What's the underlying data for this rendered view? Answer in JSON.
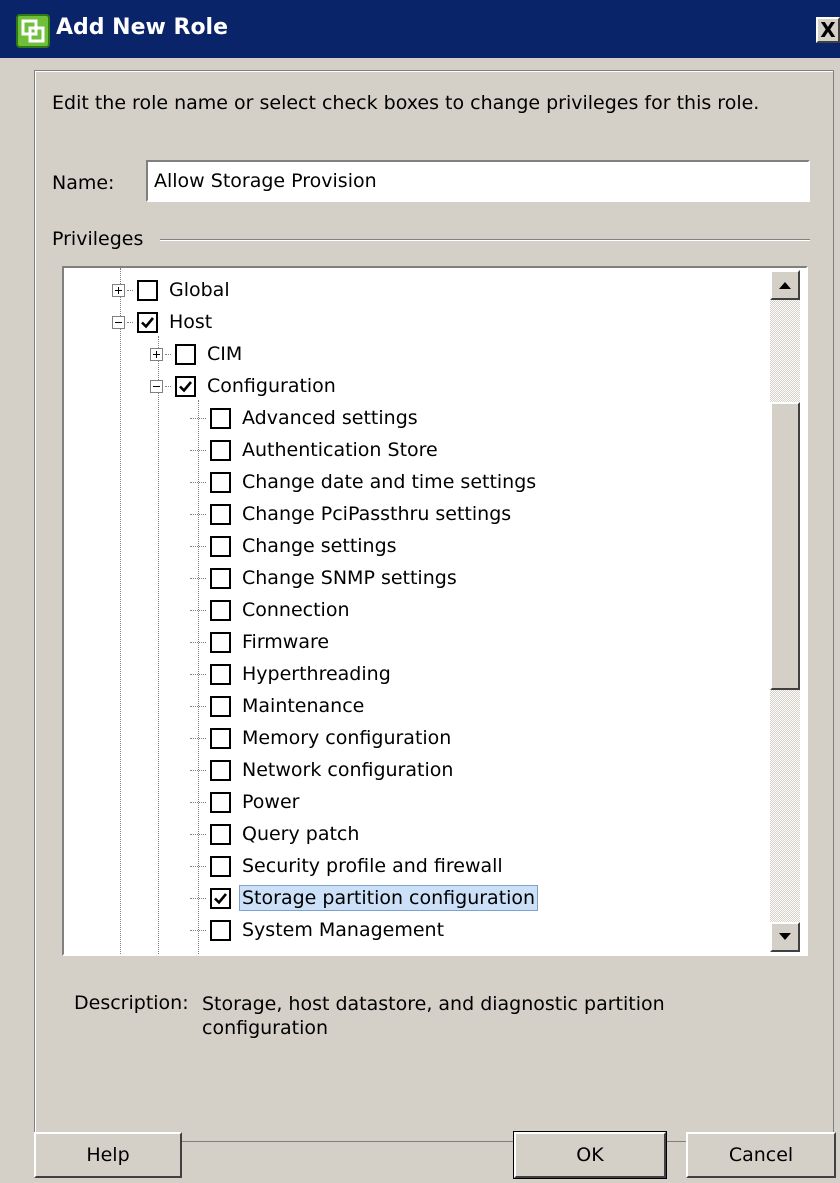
{
  "window": {
    "title": "Add New Role",
    "close_glyph": "X"
  },
  "instructions": "Edit the role name or select check boxes to change privileges for this role.",
  "name_field": {
    "label": "Name:",
    "value": "Allow Storage Provision"
  },
  "privileges": {
    "label": "Privileges",
    "tree": [
      {
        "label": "Global",
        "level": 0,
        "expander": "plus",
        "checked": false,
        "selected": false
      },
      {
        "label": "Host",
        "level": 0,
        "expander": "minus",
        "checked": true,
        "selected": false
      },
      {
        "label": "CIM",
        "level": 1,
        "expander": "plus",
        "checked": false,
        "selected": false
      },
      {
        "label": "Configuration",
        "level": 1,
        "expander": "minus",
        "checked": true,
        "selected": false
      },
      {
        "label": "Advanced settings",
        "level": 2,
        "expander": "none",
        "checked": false,
        "selected": false
      },
      {
        "label": "Authentication Store",
        "level": 2,
        "expander": "none",
        "checked": false,
        "selected": false
      },
      {
        "label": "Change date and time settings",
        "level": 2,
        "expander": "none",
        "checked": false,
        "selected": false
      },
      {
        "label": "Change PciPassthru settings",
        "level": 2,
        "expander": "none",
        "checked": false,
        "selected": false
      },
      {
        "label": "Change settings",
        "level": 2,
        "expander": "none",
        "checked": false,
        "selected": false
      },
      {
        "label": "Change SNMP settings",
        "level": 2,
        "expander": "none",
        "checked": false,
        "selected": false
      },
      {
        "label": "Connection",
        "level": 2,
        "expander": "none",
        "checked": false,
        "selected": false
      },
      {
        "label": "Firmware",
        "level": 2,
        "expander": "none",
        "checked": false,
        "selected": false
      },
      {
        "label": "Hyperthreading",
        "level": 2,
        "expander": "none",
        "checked": false,
        "selected": false
      },
      {
        "label": "Maintenance",
        "level": 2,
        "expander": "none",
        "checked": false,
        "selected": false
      },
      {
        "label": "Memory configuration",
        "level": 2,
        "expander": "none",
        "checked": false,
        "selected": false
      },
      {
        "label": "Network configuration",
        "level": 2,
        "expander": "none",
        "checked": false,
        "selected": false
      },
      {
        "label": "Power",
        "level": 2,
        "expander": "none",
        "checked": false,
        "selected": false
      },
      {
        "label": "Query patch",
        "level": 2,
        "expander": "none",
        "checked": false,
        "selected": false
      },
      {
        "label": "Security profile and firewall",
        "level": 2,
        "expander": "none",
        "checked": false,
        "selected": false
      },
      {
        "label": "Storage partition configuration",
        "level": 2,
        "expander": "none",
        "checked": true,
        "selected": true
      },
      {
        "label": "System Management",
        "level": 2,
        "expander": "none",
        "checked": false,
        "selected": false
      }
    ]
  },
  "description": {
    "label": "Description:",
    "text": "Storage, host datastore, and diagnostic partition configuration"
  },
  "buttons": {
    "help": "Help",
    "ok": "OK",
    "cancel": "Cancel"
  },
  "icons": {
    "window": "vsphere-role-icon",
    "close": "close-icon",
    "scroll_up": "scroll-up-arrow-icon",
    "scroll_down": "scroll-down-arrow-icon",
    "expand": "plus-icon",
    "collapse": "minus-icon",
    "check": "checkmark-icon"
  },
  "colors": {
    "titlebar": "#0a246a",
    "dialog_bg": "#d4d0c8",
    "selection_bg": "#cce0f8",
    "selection_border": "#7da2ce"
  }
}
